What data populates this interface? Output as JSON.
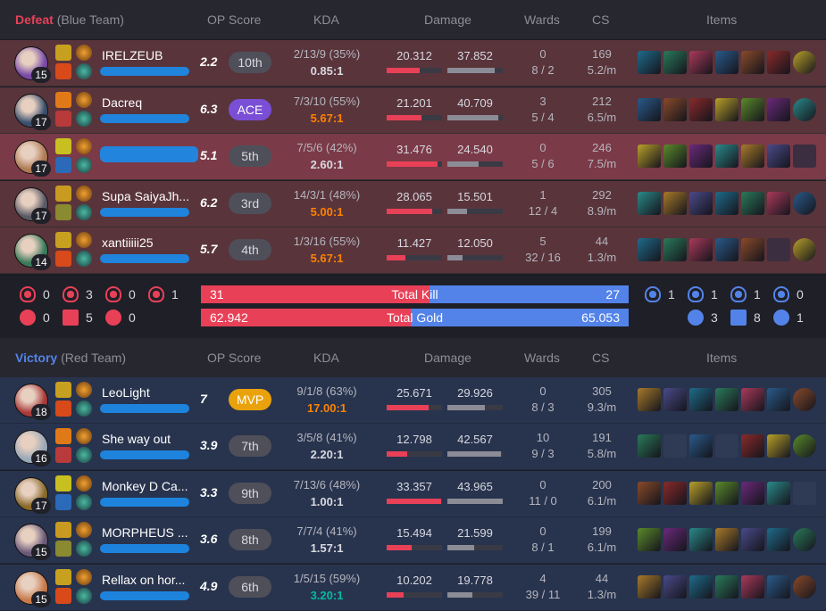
{
  "headers": {
    "op_score": "OP Score",
    "kda": "KDA",
    "damage": "Damage",
    "wards": "Wards",
    "cs": "CS",
    "items": "Items"
  },
  "team_blue": {
    "result": "Defeat",
    "team_name": "(Blue Team)",
    "players": [
      {
        "name": "IRELZEUB",
        "level": "15",
        "op": "2.2",
        "rank": "10th",
        "kda": "2/13/9 (35%)",
        "ratio": "0.85:1",
        "dmg_dealt": "20.312",
        "dmg_taken": "37.852",
        "wards_placed": "0",
        "wards_line": "8 / 2",
        "cs": "169",
        "cs_per_min": "5.2/m"
      },
      {
        "name": "Dacreq",
        "level": "17",
        "op": "6.3",
        "rank": "ACE",
        "kda": "7/3/10 (55%)",
        "ratio": "5.67:1",
        "dmg_dealt": "21.201",
        "dmg_taken": "40.709",
        "wards_placed": "3",
        "wards_line": "5 / 4",
        "cs": "212",
        "cs_per_min": "6.5/m"
      },
      {
        "name": "",
        "level": "17",
        "op": "5.1",
        "rank": "5th",
        "kda": "7/5/6 (42%)",
        "ratio": "2.60:1",
        "dmg_dealt": "31.476",
        "dmg_taken": "24.540",
        "wards_placed": "0",
        "wards_line": "5 / 6",
        "cs": "246",
        "cs_per_min": "7.5/m"
      },
      {
        "name": "Supa SaiyaJh...",
        "level": "17",
        "op": "6.2",
        "rank": "3rd",
        "kda": "14/3/1 (48%)",
        "ratio": "5.00:1",
        "dmg_dealt": "28.065",
        "dmg_taken": "15.501",
        "wards_placed": "1",
        "wards_line": "12 / 4",
        "cs": "292",
        "cs_per_min": "8.9/m"
      },
      {
        "name": "xantiiiii25",
        "level": "14",
        "op": "5.7",
        "rank": "4th",
        "kda": "1/3/16 (55%)",
        "ratio": "5.67:1",
        "dmg_dealt": "11.427",
        "dmg_taken": "12.050",
        "wards_placed": "5",
        "wards_line": "32 / 16",
        "cs": "44",
        "cs_per_min": "1.3/m"
      }
    ]
  },
  "summary": {
    "total_kill_label": "Total Kill",
    "total_gold_label": "Total Gold",
    "kills_left": "31",
    "kills_right": "27",
    "gold_left": "62.942",
    "gold_right": "65.053",
    "kill_fraction_left": 0.534,
    "gold_fraction_left": 0.49,
    "left_objectives": {
      "baron": "0",
      "dragon": "3",
      "herald": "0",
      "grub": "1",
      "tower": "0",
      "inhib": "5",
      "other": "0"
    },
    "right_objectives": {
      "baron": "1",
      "dragon": "1",
      "herald": "1",
      "grub": "0",
      "tower": "3",
      "inhib": "8",
      "other": "1"
    }
  },
  "team_red": {
    "result": "Victory",
    "team_name": "(Red Team)",
    "players": [
      {
        "name": "LeoLight",
        "level": "18",
        "op": "7",
        "rank": "MVP",
        "kda": "9/1/8 (63%)",
        "ratio": "17.00:1",
        "dmg_dealt": "25.671",
        "dmg_taken": "29.926",
        "wards_placed": "0",
        "wards_line": "8 / 3",
        "cs": "305",
        "cs_per_min": "9.3/m"
      },
      {
        "name": "She way out",
        "level": "16",
        "op": "3.9",
        "rank": "7th",
        "kda": "3/5/8 (41%)",
        "ratio": "2.20:1",
        "dmg_dealt": "12.798",
        "dmg_taken": "42.567",
        "wards_placed": "10",
        "wards_line": "9 / 3",
        "cs": "191",
        "cs_per_min": "5.8/m"
      },
      {
        "name": "Monkey D Ca...",
        "level": "17",
        "op": "3.3",
        "rank": "9th",
        "kda": "7/13/6 (48%)",
        "ratio": "1.00:1",
        "dmg_dealt": "33.357",
        "dmg_taken": "43.965",
        "wards_placed": "0",
        "wards_line": "11 / 0",
        "cs": "200",
        "cs_per_min": "6.1/m"
      },
      {
        "name": "MORPHEUS ...",
        "level": "15",
        "op": "3.6",
        "rank": "8th",
        "kda": "7/7/4 (41%)",
        "ratio": "1.57:1",
        "dmg_dealt": "15.494",
        "dmg_taken": "21.599",
        "wards_placed": "0",
        "wards_line": "8 / 1",
        "cs": "199",
        "cs_per_min": "6.1/m"
      },
      {
        "name": "Rellax on hor...",
        "level": "15",
        "op": "4.9",
        "rank": "6th",
        "kda": "1/5/15 (59%)",
        "ratio": "3.20:1",
        "dmg_dealt": "10.202",
        "dmg_taken": "19.778",
        "wards_placed": "4",
        "wards_line": "39 / 11",
        "cs": "44",
        "cs_per_min": "1.3/m"
      }
    ]
  },
  "colors": {
    "red_team": "#e84057",
    "blue_team": "#5383e8",
    "gold_ratio": "#ff8200",
    "teal_ratio": "#00bba3",
    "ace": "#7a4fd6",
    "mvp": "#e9a20c"
  }
}
